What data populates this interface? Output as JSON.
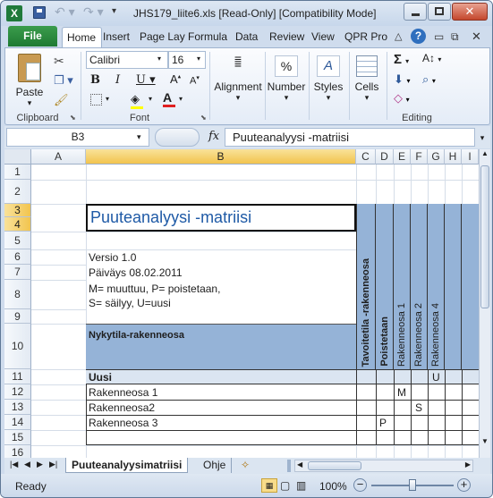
{
  "window": {
    "title": "JHS179_liite6.xls  [Read-Only]  [Compatibility Mode]"
  },
  "tabs": [
    "File",
    "Home",
    "Insert",
    "Page Lay",
    "Formula",
    "Data",
    "Review",
    "View",
    "QPR Pro"
  ],
  "ribbon": {
    "clipboard": {
      "paste": "Paste",
      "label": "Clipboard"
    },
    "font": {
      "name": "Calibri",
      "size": "16",
      "label": "Font"
    },
    "alignment": {
      "label": "Alignment"
    },
    "number": {
      "label": "Number",
      "symbol": "%"
    },
    "styles": {
      "label": "Styles"
    },
    "cells": {
      "label": "Cells"
    },
    "editing": {
      "label": "Editing"
    }
  },
  "formula_bar": {
    "name_box": "B3",
    "fx": "fx",
    "content": "Puuteanalyysi -matriisi"
  },
  "columns": [
    "A",
    "B",
    "C",
    "D",
    "E",
    "F",
    "G",
    "H",
    "I"
  ],
  "rows": [
    "1",
    "2",
    "3",
    "4",
    "5",
    "6",
    "7",
    "8",
    "9",
    "10",
    "11",
    "12",
    "13",
    "14",
    "15",
    "16"
  ],
  "sheet": {
    "title": "Puuteanalyysi -matriisi",
    "version": "Versio 1.0",
    "date": "Päiväys 08.02.2011",
    "legend1": "M= muuttuu, P= poistetaan,",
    "legend2": "S= säilyy, U=uusi",
    "current_header": "Nykytila-rakenneosa",
    "target_header": "Tavoitetila -rakenneosa",
    "removed_header": "Poistetaan",
    "part1": "Rakenneosa 1",
    "part2": "Rakenneosa 2",
    "part4": "Rakenneosa 4",
    "new_label": "Uusi",
    "row12": "Rakenneosa 1",
    "row13": "Rakenneosa2",
    "row14": "Rakenneosa 3",
    "mark_u": "U",
    "mark_m": "M",
    "mark_s": "S",
    "mark_p": "P"
  },
  "sheet_tabs": [
    "Puuteanalyysimatriisi",
    "Ohje"
  ],
  "status": {
    "ready": "Ready",
    "zoom": "100%"
  },
  "colors": {
    "header_fill": "#95b3d7",
    "selected_header": "#f5d06c",
    "file_tab": "#2a8a3e"
  }
}
